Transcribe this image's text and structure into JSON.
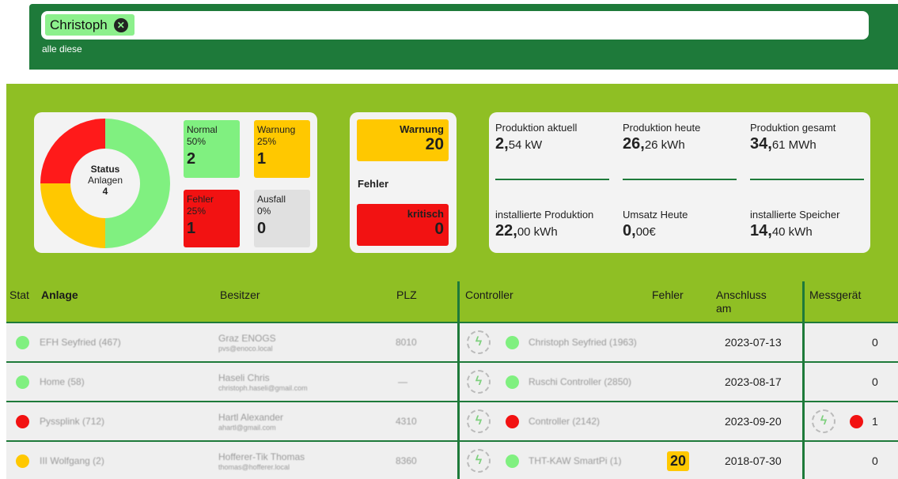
{
  "search": {
    "chip_label": "Christoph",
    "chip_remove_icon": "close-circle-icon",
    "scope_label": "alle diese"
  },
  "status": {
    "title": "Status",
    "subtitle": "Anlagen",
    "total": "4",
    "normal": {
      "label": "Normal",
      "pct": "50%",
      "count": "2",
      "color": "#80f080"
    },
    "warnung": {
      "label": "Warnung",
      "pct": "25%",
      "count": "1",
      "color": "#ffc800"
    },
    "fehler": {
      "label": "Fehler",
      "pct": "25%",
      "count": "1",
      "color": "#f21212"
    },
    "ausfall": {
      "label": "Ausfall",
      "pct": "0%",
      "count": "0",
      "color": "#e0e0e0"
    }
  },
  "alarms": {
    "warnung_label": "Warnung",
    "warnung_count": "20",
    "fehler_label": "Fehler",
    "kritisch_label": "kritisch",
    "kritisch_count": "0"
  },
  "production": [
    {
      "label": "Produktion aktuell",
      "int": "2,",
      "dec": "54",
      "unit": "kW"
    },
    {
      "label": "Produktion heute",
      "int": "26,",
      "dec": "26",
      "unit": "kWh"
    },
    {
      "label": "Produktion gesamt",
      "int": "34,",
      "dec": "61",
      "unit": "MWh"
    },
    {
      "label": "installierte Produktion",
      "int": "22,",
      "dec": "00",
      "unit": "kWh"
    },
    {
      "label": "Umsatz Heute",
      "int": "0,",
      "dec": "00",
      "unit": "€"
    },
    {
      "label": "installierte Speicher",
      "int": "14,",
      "dec": "40",
      "unit": "kWh"
    }
  ],
  "table": {
    "headers": {
      "stat": "Stat",
      "anlage": "Anlage",
      "besitzer": "Besitzer",
      "plz": "PLZ",
      "controller": "Controller",
      "fehler": "Fehler",
      "anschluss": "Anschluss am",
      "messgeraet": "Messgerät"
    },
    "rows": [
      {
        "status": "#80f080",
        "anlage": "EFH Seyfried (467)",
        "owner": "Graz ENOGS",
        "owner_sub": "pvs@enoco.local",
        "plz": "8010",
        "ctl_status": "#80f080",
        "controller": "Christoph Seyfried (1963)",
        "fehler": "",
        "date": "2023-07-13",
        "meter": "0",
        "meter_status": ""
      },
      {
        "status": "#80f080",
        "anlage": "Home (58)",
        "owner": "Haseli Chris",
        "owner_sub": "christoph.haseli@gmail.com",
        "plz": "—",
        "ctl_status": "#80f080",
        "controller": "Ruschi Controller (2850)",
        "fehler": "",
        "date": "2023-08-17",
        "meter": "0",
        "meter_status": ""
      },
      {
        "status": "#f21212",
        "anlage": "Pyssplink (712)",
        "owner": "Hartl Alexander",
        "owner_sub": "ahartl@gmail.com",
        "plz": "4310",
        "ctl_status": "#f21212",
        "controller": "Controller (2142)",
        "fehler": "",
        "date": "2023-09-20",
        "meter": "1",
        "meter_status": "#f21212"
      },
      {
        "status": "#ffc800",
        "anlage": "III Wolfgang (2)",
        "owner": "Hofferer-Tik Thomas",
        "owner_sub": "thomas@hofferer.local",
        "plz": "8360",
        "ctl_status": "#80f080",
        "controller": "THT-KAW SmartPi (1)",
        "fehler": "20",
        "date": "2018-07-30",
        "meter": "0",
        "meter_status": ""
      }
    ]
  }
}
